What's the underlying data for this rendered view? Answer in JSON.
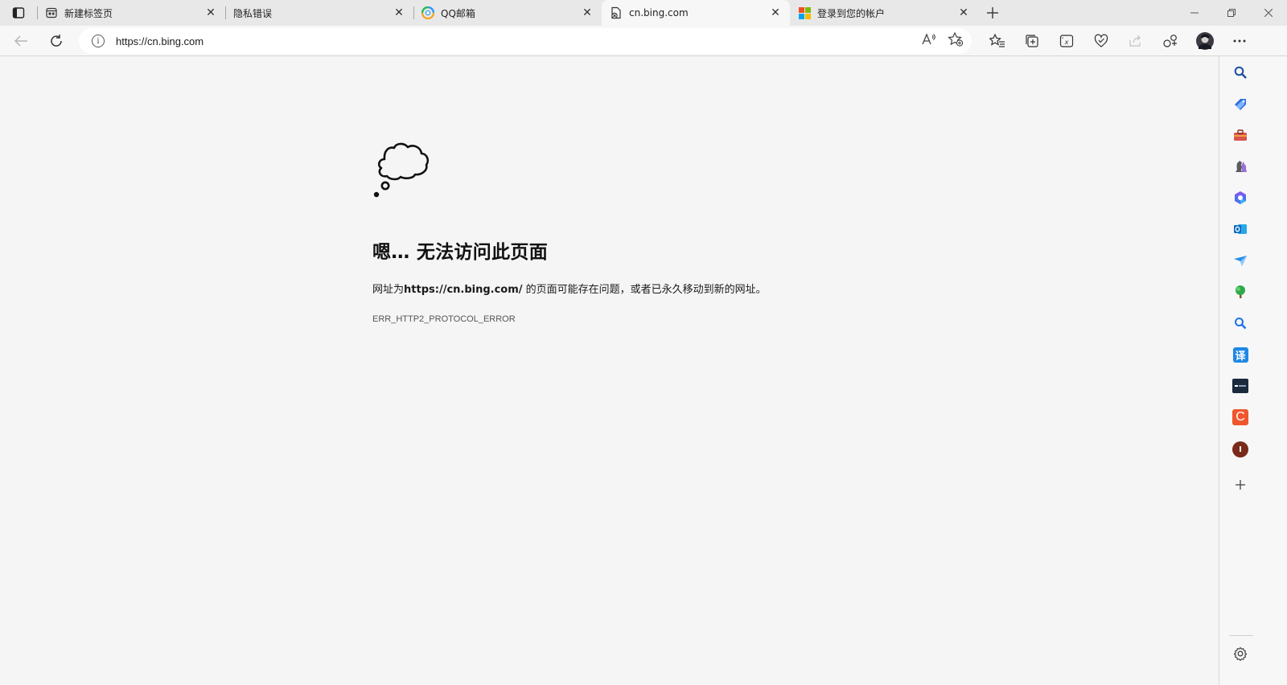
{
  "tabs": [
    {
      "title": "新建标签页",
      "favicon": "newtab-icon"
    },
    {
      "title": "隐私错误",
      "favicon": ""
    },
    {
      "title": "QQ邮箱",
      "favicon": "qqmail-icon"
    },
    {
      "title": "cn.bing.com",
      "favicon": "page-error-icon"
    },
    {
      "title": "登录到您的帐户",
      "favicon": "microsoft-logo-icon"
    }
  ],
  "toolbar": {
    "url": "https://cn.bing.com"
  },
  "error": {
    "title": "嗯… 无法访问此页面",
    "desc_prefix": "网址为",
    "desc_url": "https://cn.bing.com/",
    "desc_suffix": " 的页面可能存在问题，或者已永久移动到新的网址。",
    "code": "ERR_HTTP2_PROTOCOL_ERROR"
  },
  "sidebar": {
    "items": [
      "search-icon",
      "shopping-tag-icon",
      "tools-icon",
      "games-icon",
      "office-icon",
      "outlook-icon",
      "send-icon",
      "tree-icon",
      "search-blue-icon",
      "translate-icon",
      "dark-app-icon",
      "c-app-icon",
      "profile-circle-icon",
      "add-icon"
    ],
    "translate_label": "译",
    "c_label": "C",
    "circle_label": "I"
  },
  "colors": {
    "tabstrip": "#e8e8e8",
    "active_tab": "#f7f7f7",
    "page_bg": "#f5f5f5"
  }
}
